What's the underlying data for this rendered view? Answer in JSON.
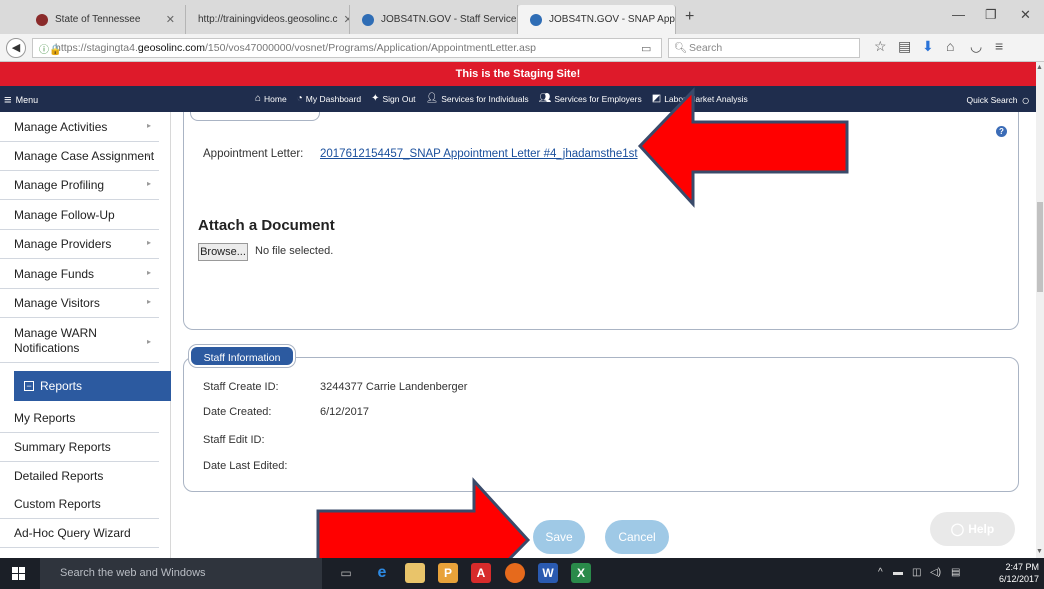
{
  "browser": {
    "tabs": [
      {
        "label": "State of Tennessee",
        "icon": "tn-seal-icon",
        "active": false
      },
      {
        "label": "http://trainingvideos.geosolinc.c",
        "icon": "none",
        "active": false
      },
      {
        "label": "JOBS4TN.GOV - Staff Service",
        "icon": "jobs4tn-icon",
        "active": false
      },
      {
        "label": "JOBS4TN.GOV - SNAP Appo",
        "icon": "jobs4tn-icon",
        "active": true
      }
    ],
    "url_prefix": "https://stagingta4.",
    "url_domain": "geosolinc.com",
    "url_path": "/150/vos47000000/vosnet/Programs/Application/AppointmentLetter.asp",
    "search_placeholder": "Search"
  },
  "banner": {
    "text": "This is the Staging Site!",
    "color": "#de1a2a"
  },
  "sitenav": {
    "menu_label": "Menu",
    "links": [
      {
        "label": "Home",
        "icon": "home-icon"
      },
      {
        "label": "My Dashboard",
        "icon": "dashboard-icon"
      },
      {
        "label": "Sign Out",
        "icon": "signout-icon"
      },
      {
        "label": "Services for Individuals",
        "icon": "individual-icon"
      },
      {
        "label": "Services for Employers",
        "icon": "employers-icon"
      },
      {
        "label": "Labor Market Analysis",
        "icon": "chart-icon"
      }
    ],
    "quick_search": "Quick Search"
  },
  "sidebar": {
    "items": [
      {
        "label": "Manage Activities",
        "chevron": true
      },
      {
        "label": "Manage Case Assignment",
        "chevron": true
      },
      {
        "label": "Manage Profiling",
        "chevron": true
      },
      {
        "label": "Manage Follow-Up",
        "chevron": false
      },
      {
        "label": "Manage Providers",
        "chevron": true
      },
      {
        "label": "Manage Funds",
        "chevron": true
      },
      {
        "label": "Manage Visitors",
        "chevron": true
      },
      {
        "label": "Manage WARN Notifications",
        "chevron": true
      }
    ],
    "reports_header": "Reports",
    "report_items": [
      {
        "label": "My Reports"
      },
      {
        "label": "Summary Reports"
      },
      {
        "label": "Detailed Reports"
      },
      {
        "label": "Custom Reports"
      },
      {
        "label": "Ad-Hoc Query Wizard"
      }
    ]
  },
  "main": {
    "appointment_label": "Appointment Letter:",
    "appointment_link": "2017612154457_SNAP Appointment Letter #4_jhadamsthe1st",
    "attach_title": "Attach a Document",
    "browse_label": "Browse...",
    "no_file": "No file selected.",
    "staff_section_title": "Staff Information",
    "staff_rows": [
      {
        "label": "Staff Create ID:",
        "value": "3244377 Carrie Landenberger"
      },
      {
        "label": "Date Created:",
        "value": "6/12/2017"
      },
      {
        "label": "Staff Edit ID:",
        "value": ""
      },
      {
        "label": "Date Last Edited:",
        "value": ""
      }
    ],
    "save_label": "Save",
    "cancel_label": "Cancel",
    "help_label": "Help"
  },
  "taskbar": {
    "search_text": "Search the web and Windows",
    "time": "2:47 PM",
    "date": "6/12/2017"
  },
  "colors": {
    "navy": "#1f2d4d",
    "accent_blue": "#2c5aa0",
    "button_blue": "#9fc9e6",
    "arrow_red": "#ff0000"
  }
}
